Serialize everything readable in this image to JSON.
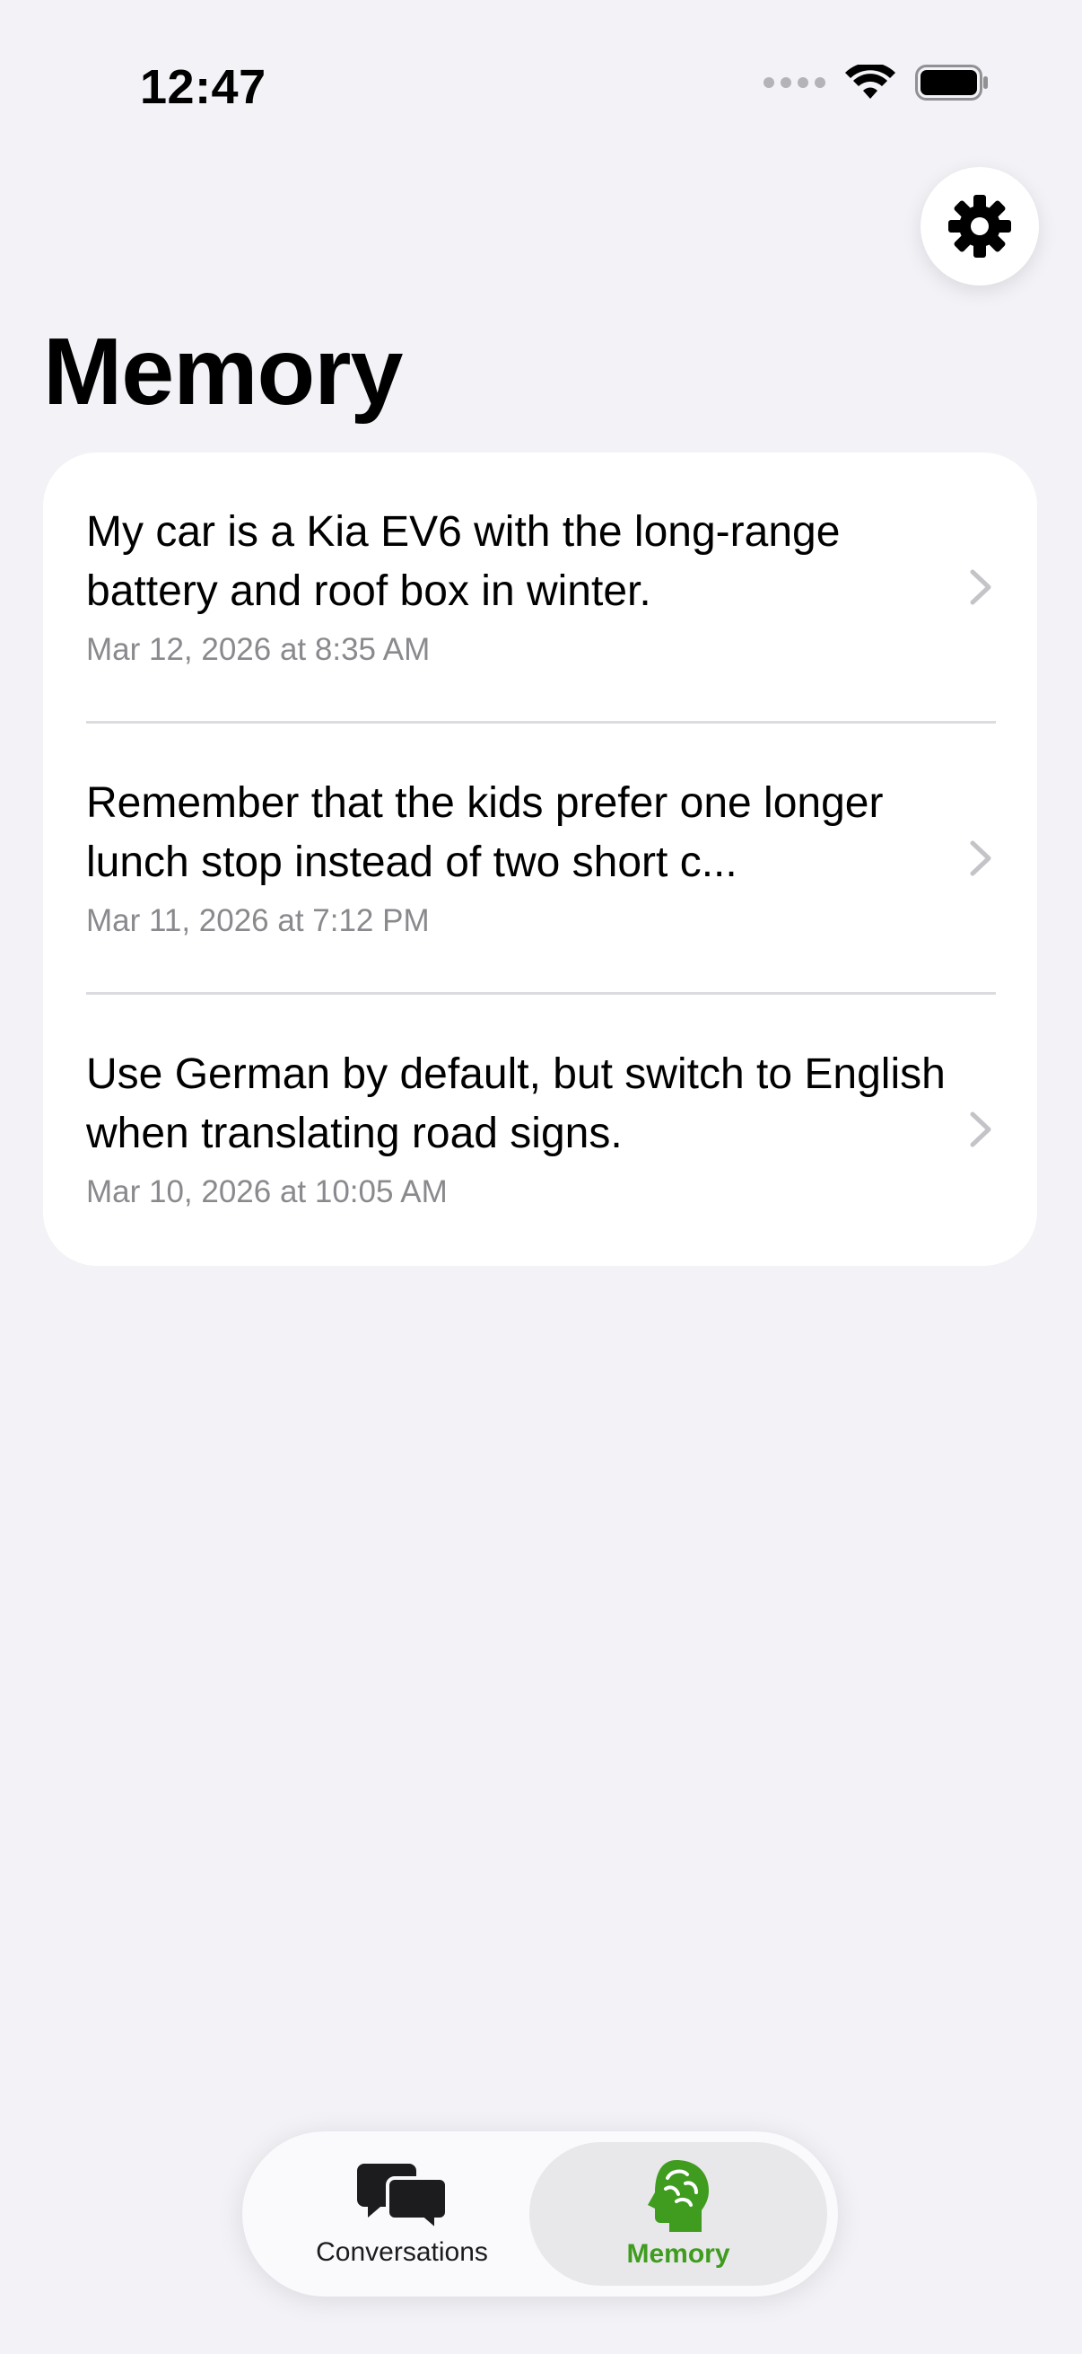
{
  "status_bar": {
    "time": "12:47"
  },
  "header": {
    "title": "Memory",
    "settings_icon": "gear-icon"
  },
  "memories": [
    {
      "text": "My car is a Kia EV6 with the long-range battery and roof box in winter.",
      "date": "Mar 12, 2026 at 8:35 AM"
    },
    {
      "text": "Remember that the kids prefer one longer lunch stop instead of two short c...",
      "date": "Mar 11, 2026 at 7:12 PM"
    },
    {
      "text": "Use German by default, but switch to English when translating road signs.",
      "date": "Mar 10, 2026 at 10:05 AM"
    }
  ],
  "tabs": [
    {
      "label": "Conversations",
      "icon": "chat-bubbles-icon",
      "selected": false
    },
    {
      "label": "Memory",
      "icon": "brain-head-icon",
      "selected": true
    }
  ],
  "colors": {
    "accent": "#3f9c1e",
    "background": "#f2f2f7",
    "card": "#ffffff",
    "secondary_text": "#8a8a8e"
  }
}
